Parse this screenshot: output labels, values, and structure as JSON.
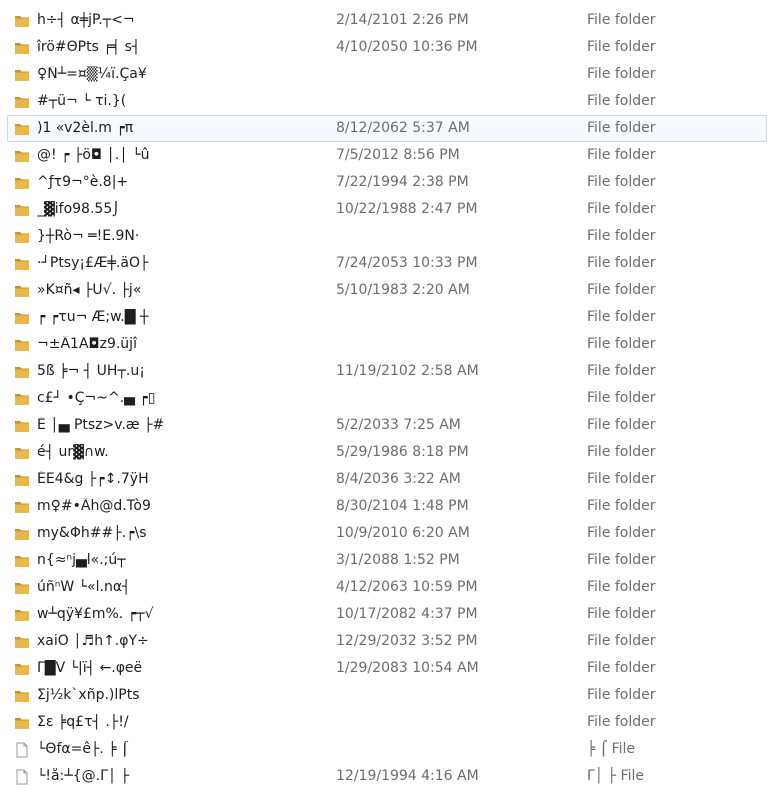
{
  "files": [
    {
      "icon": "folder-icon",
      "name": "h÷┤ α╪jP.┬<¬",
      "date": "2/14/2101 2:26 PM",
      "type": "File folder"
    },
    {
      "icon": "folder-icon",
      "name": "îrö#ΘPts ╒╡ s┤",
      "date": "4/10/2050 10:36 PM",
      "type": "File folder"
    },
    {
      "icon": "folder-icon",
      "name": "♀Ñ┴=¤▒¼ï.Ça¥",
      "date": "",
      "type": "File folder"
    },
    {
      "icon": "folder-icon",
      "name": "#┬ü¬ └ τi.}(",
      "date": "",
      "type": "File folder"
    },
    {
      "icon": "folder-icon",
      "name": ")1 «v2èl.m ┍π",
      "date": "8/12/2062 5:37 AM",
      "type": "File folder"
    },
    {
      "icon": "folder-icon",
      "name": "@! ┍ ├ö◘ │.│ └û",
      "date": "7/5/2012 8:56 PM",
      "type": "File folder"
    },
    {
      "icon": "folder-icon",
      "name": "^ƒτ9¬°è.8|+",
      "date": "7/22/1994 2:38 PM",
      "type": "File folder"
    },
    {
      "icon": "folder-icon",
      "name": "_▓ifo98.55⌡",
      "date": "10/22/1988 2:47 PM",
      "type": "File folder"
    },
    {
      "icon": "folder-icon",
      "name": "}┼Rò¬ ═!E.9N·",
      "date": "",
      "type": "File folder"
    },
    {
      "icon": "folder-icon",
      "name": "·┘Ptsy¡£Æ╪.äÖ├",
      "date": "7/24/2053 10:33 PM",
      "type": "File folder"
    },
    {
      "icon": "folder-icon",
      "name": "»K¤ñ◂ ├U√. ├j«",
      "date": "5/10/1983 2:20 AM",
      "type": "File folder"
    },
    {
      "icon": "folder-icon",
      "name": " ┍ ┍τu¬ Æ;w.█ ┼",
      "date": "",
      "type": "File folder"
    },
    {
      "icon": "folder-icon",
      "name": "¬±Ä1A◘z9.üjî",
      "date": "",
      "type": "File folder"
    },
    {
      "icon": "folder-icon",
      "name": "5ß ╞¬ ┤ UH┬.u¡",
      "date": "11/19/2102 2:58 AM",
      "type": "File folder"
    },
    {
      "icon": "folder-icon",
      "name": "c£┘ •Ç¬~^.▄ ┍▯",
      "date": "",
      "type": "File folder"
    },
    {
      "icon": "folder-icon",
      "name": "É │▄ Ptsz>v.æ ├#",
      "date": "5/2/2033 7:25 AM",
      "type": "File folder"
    },
    {
      "icon": "folder-icon",
      "name": "é┤ ur▓∩w.",
      "date": "5/29/1986 8:18 PM",
      "type": "File folder"
    },
    {
      "icon": "folder-icon",
      "name": "ÉE4&g ├┍↕.7ÿH",
      "date": "8/4/2036 3:22 AM",
      "type": "File folder"
    },
    {
      "icon": "folder-icon",
      "name": "m♀#•Äh@d.Tò9",
      "date": "8/30/2104 1:48 PM",
      "type": "File folder"
    },
    {
      "icon": "folder-icon",
      "name": "my&Φh##├.┍\\s",
      "date": "10/9/2010 6:20 AM",
      "type": "File folder"
    },
    {
      "icon": "folder-icon",
      "name": "n{≈ⁿj▄l«.;ú┬",
      "date": "3/1/2088 1:52 PM",
      "type": "File folder"
    },
    {
      "icon": "folder-icon",
      "name": "úñⁿW └«l.nα┤",
      "date": "4/12/2063 10:59 PM",
      "type": "File folder"
    },
    {
      "icon": "folder-icon",
      "name": "w┴qÿ¥£m%. ┍┬√",
      "date": "10/17/2082 4:37 PM",
      "type": "File folder"
    },
    {
      "icon": "folder-icon",
      "name": "xaiÖ │♬h↑.φY÷",
      "date": "12/29/2032 3:52 PM",
      "type": "File folder"
    },
    {
      "icon": "folder-icon",
      "name": "Γ█V └|ï┤ ←.φeë",
      "date": "1/29/2083 10:54 AM",
      "type": "File folder"
    },
    {
      "icon": "folder-icon",
      "name": "Σj½k`xñp.)lPts",
      "date": "",
      "type": "File folder"
    },
    {
      "icon": "folder-icon",
      "name": "Σε ╞q£τ┤ .├!/",
      "date": "",
      "type": "File folder"
    },
    {
      "icon": "file-icon",
      "name": " └Θfα=ê├. ╞ ⌠",
      "date": "",
      "type": "╞ ⌠ File"
    },
    {
      "icon": "file-icon",
      "name": "└!å:┴{@.Γ│ ├",
      "date": "12/19/1994 4:16 AM",
      "type": "Γ│ ├ File"
    }
  ],
  "selected_index": 4,
  "colors": {
    "folder": "#e8b84a",
    "folder_dark": "#c8932a",
    "selection_border": "#c6dcef"
  }
}
